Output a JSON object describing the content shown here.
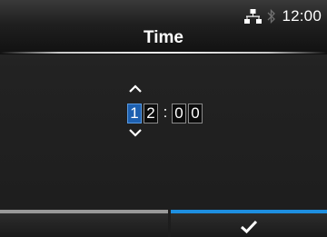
{
  "status_bar": {
    "time": "12:00",
    "network_icon": "network-icon",
    "bluetooth_icon": "bluetooth-icon"
  },
  "header": {
    "title": "Time"
  },
  "time_editor": {
    "digits": [
      "1",
      "2",
      "0",
      "0"
    ],
    "separator": ":",
    "selected_index": 0,
    "up_icon": "chevron-up-icon",
    "down_icon": "chevron-down-icon"
  },
  "buttons": {
    "left": {
      "label": "",
      "bar_color": "#9a9a9a"
    },
    "right": {
      "label": "",
      "icon": "check-icon",
      "bar_color": "#1e8fe0"
    }
  },
  "colors": {
    "selected_digit": "#1d60b0",
    "accent": "#1e8fe0"
  }
}
